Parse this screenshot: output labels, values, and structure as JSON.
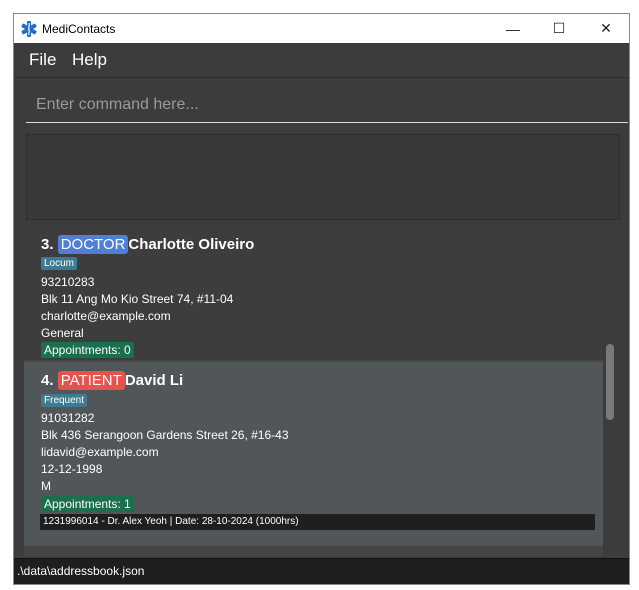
{
  "window": {
    "title": "MediContacts",
    "icon": "medical-star-icon",
    "controls": {
      "minimize": "—",
      "maximize": "☐",
      "close": "✕"
    }
  },
  "menu": {
    "file": "File",
    "help": "Help"
  },
  "command": {
    "placeholder": "Enter command here..."
  },
  "result_display": {
    "text": ""
  },
  "persons": [
    {
      "index": "3.",
      "role": "DOCTOR",
      "role_color": "#4f7fd6",
      "name": "Charlotte Oliveiro",
      "tag": "Locum",
      "phone": "93210283",
      "address": "Blk 11 Ang Mo Kio Street 74, #11-04",
      "email": "charlotte@example.com",
      "specialty": "General",
      "appointments_label": "Appointments: 0"
    },
    {
      "index": "4.",
      "role": "PATIENT",
      "role_color": "#e3534f",
      "name": "David Li",
      "tag": "Frequent",
      "phone": "91031282",
      "address": "Blk 436 Serangoon Gardens Street 26, #16-43",
      "email": "lidavid@example.com",
      "dob": "12-12-1998",
      "gender": "M",
      "appointments_label": "Appointments: 1",
      "appointments": [
        "1231996014 - Dr. Alex Yeoh | Date: 28-10-2024 (1000hrs)"
      ]
    }
  ],
  "status": {
    "path": ".\\data\\addressbook.json"
  },
  "colors": {
    "background": "#3c3c3c",
    "tag": "#3e7b91",
    "appointments_tag": "#1b6e4e"
  }
}
